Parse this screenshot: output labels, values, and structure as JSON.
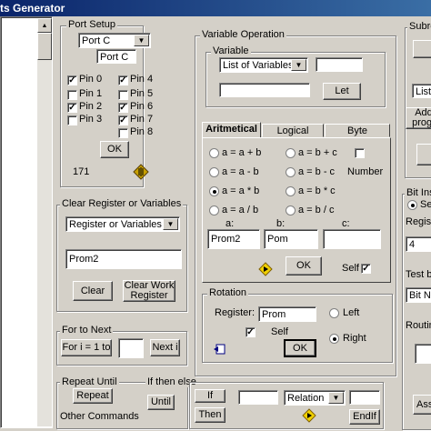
{
  "window": {
    "title": "ts Generator"
  },
  "port_setup": {
    "label": "Port Setup",
    "port_value": "Port C",
    "port_field": "Port C",
    "pins": [
      {
        "label": "Pin 0",
        "checked": true
      },
      {
        "label": "Pin 1",
        "checked": false
      },
      {
        "label": "Pin 2",
        "checked": true
      },
      {
        "label": "Pin 3",
        "checked": false
      },
      {
        "label": "Pin 4",
        "checked": true
      },
      {
        "label": "Pin 5",
        "checked": false
      },
      {
        "label": "Pin 6",
        "checked": true
      },
      {
        "label": "Pin 7",
        "checked": true
      },
      {
        "label": "Pin 8",
        "checked": false
      }
    ],
    "ok_label": "OK",
    "value_text": "171"
  },
  "clear_register": {
    "label": "Clear Register or Variables",
    "combo_value": "Register or Variables",
    "field_value": "Prom2",
    "clear_label": "Clear",
    "clear_work_label_1": "Clear Work",
    "clear_work_label_2": "Register"
  },
  "for_to_next": {
    "label": "For to Next",
    "for_label": "For i = 1 to",
    "next_label": "Next i",
    "field_value": ""
  },
  "bottom": {
    "repeat_until_label": "Repeat Until",
    "repeat_button": "Repeat",
    "other_commands": "Other Commands",
    "if_then_else_label": "If then else",
    "until_button": "Until",
    "if_button": "If",
    "then_button": "Then",
    "relation_value": "Relation",
    "endif_button": "EndIf"
  },
  "variable_operation": {
    "label": "Variable Operation",
    "variable_label": "Variable",
    "variable_combo": "List of Variables",
    "let_label": "Let",
    "tabs": [
      "Aritmetical",
      "Logical",
      "Byte"
    ],
    "ops_left": [
      "a = a + b",
      "a = a - b",
      "a = a * b",
      "a = a / b"
    ],
    "ops_right": [
      "a = b + c",
      "a = b - c",
      "a = b * c",
      "a = b / c"
    ],
    "selected_op": "a = a * b",
    "number_label": "Number",
    "a_label": "a:",
    "b_label": "b:",
    "c_label": "c:",
    "a_value": "Prom2",
    "b_value": "Pom",
    "c_value": "",
    "ok_label": "OK",
    "self_label": "Self"
  },
  "rotation": {
    "label": "Rotation",
    "register_label": "Register:",
    "register_value": "Prom",
    "left_label": "Left",
    "right_label": "Right",
    "self_label": "Self",
    "ok_label": "OK"
  },
  "subroutine": {
    "label": "Subrou",
    "list_value": "List",
    "add_label_1": "Add",
    "add_label_2": "progr"
  },
  "bit_instruction": {
    "label": "Bit Ins",
    "radio_label": "Se",
    "register_label": "Regist",
    "field_value": "4",
    "test_label": "Test b",
    "test_field": "Bit Nu",
    "routine_label": "Routin",
    "ass_label": "Ass"
  }
}
